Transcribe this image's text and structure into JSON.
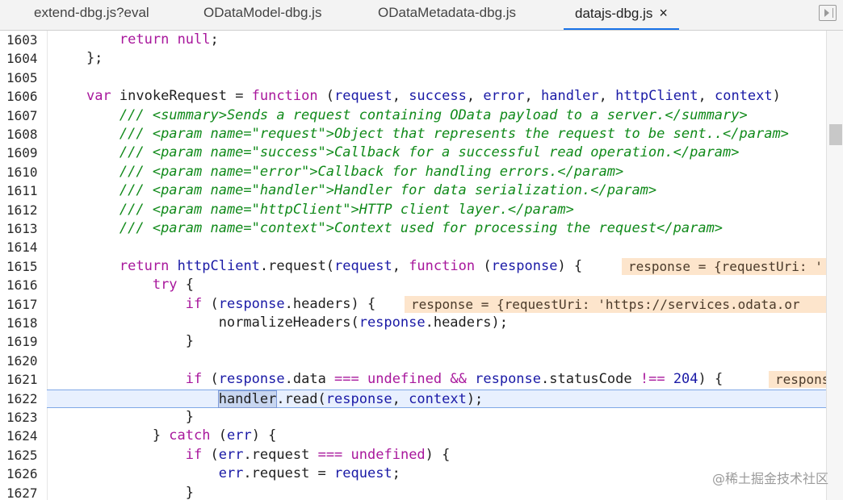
{
  "tabs": [
    {
      "label": "extend-dbg.js?eval"
    },
    {
      "label": "ODataModel-dbg.js"
    },
    {
      "label": "ODataMetadata-dbg.js"
    },
    {
      "label": "datajs-dbg.js",
      "close": "×"
    }
  ],
  "editor": {
    "lines": [
      {
        "n": "1603",
        "tokens": [
          {
            "t": "        "
          },
          {
            "t": "return",
            "c": "kw"
          },
          {
            "t": " "
          },
          {
            "t": "null",
            "c": "kw"
          },
          {
            "t": ";"
          }
        ]
      },
      {
        "n": "1604",
        "tokens": [
          {
            "t": "    };"
          }
        ]
      },
      {
        "n": "1605",
        "tokens": []
      },
      {
        "n": "1606",
        "tokens": [
          {
            "t": "    "
          },
          {
            "t": "var",
            "c": "kw"
          },
          {
            "t": " invokeRequest = "
          },
          {
            "t": "function",
            "c": "kw"
          },
          {
            "t": " ("
          },
          {
            "t": "request",
            "c": "id"
          },
          {
            "t": ", "
          },
          {
            "t": "success",
            "c": "id"
          },
          {
            "t": ", "
          },
          {
            "t": "error",
            "c": "id"
          },
          {
            "t": ", "
          },
          {
            "t": "handler",
            "c": "id"
          },
          {
            "t": ", "
          },
          {
            "t": "httpClient",
            "c": "id"
          },
          {
            "t": ", "
          },
          {
            "t": "context",
            "c": "id"
          },
          {
            "t": ")"
          }
        ]
      },
      {
        "n": "1607",
        "tokens": [
          {
            "t": "        "
          },
          {
            "t": "/// <summary>Sends a request containing OData payload to a server.</summary>",
            "c": "cm"
          }
        ]
      },
      {
        "n": "1608",
        "tokens": [
          {
            "t": "        "
          },
          {
            "t": "/// <param name=\"request\">Object that represents the request to be sent..</param>",
            "c": "cm"
          }
        ]
      },
      {
        "n": "1609",
        "tokens": [
          {
            "t": "        "
          },
          {
            "t": "/// <param name=\"success\">Callback for a successful read operation.</param>",
            "c": "cm"
          }
        ]
      },
      {
        "n": "1610",
        "tokens": [
          {
            "t": "        "
          },
          {
            "t": "/// <param name=\"error\">Callback for handling errors.</param>",
            "c": "cm"
          }
        ]
      },
      {
        "n": "1611",
        "tokens": [
          {
            "t": "        "
          },
          {
            "t": "/// <param name=\"handler\">Handler for data serialization.</param>",
            "c": "cm"
          }
        ]
      },
      {
        "n": "1612",
        "tokens": [
          {
            "t": "        "
          },
          {
            "t": "/// <param name=\"httpClient\">HTTP client layer.</param>",
            "c": "cm"
          }
        ]
      },
      {
        "n": "1613",
        "tokens": [
          {
            "t": "        "
          },
          {
            "t": "/// <param name=\"context\">Context used for processing the request</param>",
            "c": "cm"
          }
        ]
      },
      {
        "n": "1614",
        "tokens": []
      },
      {
        "n": "1615",
        "tokens": [
          {
            "t": "        "
          },
          {
            "t": "return",
            "c": "kw"
          },
          {
            "t": " "
          },
          {
            "t": "httpClient",
            "c": "id"
          },
          {
            "t": ".request("
          },
          {
            "t": "request",
            "c": "id"
          },
          {
            "t": ", "
          },
          {
            "t": "function",
            "c": "kw"
          },
          {
            "t": " ("
          },
          {
            "t": "response",
            "c": "id"
          },
          {
            "t": ") {"
          }
        ],
        "hint": "response = {requestUri: '"
      },
      {
        "n": "1616",
        "tokens": [
          {
            "t": "            "
          },
          {
            "t": "try",
            "c": "kw"
          },
          {
            "t": " {"
          }
        ]
      },
      {
        "n": "1617",
        "tokens": [
          {
            "t": "                "
          },
          {
            "t": "if",
            "c": "kw"
          },
          {
            "t": " ("
          },
          {
            "t": "response",
            "c": "id"
          },
          {
            "t": ".headers) {"
          }
        ],
        "hint": "response = {requestUri: 'https://services.odata.or"
      },
      {
        "n": "1618",
        "tokens": [
          {
            "t": "                    normalizeHeaders("
          },
          {
            "t": "response",
            "c": "id"
          },
          {
            "t": ".headers);"
          }
        ]
      },
      {
        "n": "1619",
        "tokens": [
          {
            "t": "                }"
          }
        ]
      },
      {
        "n": "1620",
        "tokens": []
      },
      {
        "n": "1621",
        "tokens": [
          {
            "t": "                "
          },
          {
            "t": "if",
            "c": "kw"
          },
          {
            "t": " ("
          },
          {
            "t": "response",
            "c": "id"
          },
          {
            "t": ".data "
          },
          {
            "t": "===",
            "c": "kw"
          },
          {
            "t": " "
          },
          {
            "t": "undefined",
            "c": "kw"
          },
          {
            "t": " "
          },
          {
            "t": "&&",
            "c": "kw"
          },
          {
            "t": " "
          },
          {
            "t": "response",
            "c": "id"
          },
          {
            "t": ".statusCode "
          },
          {
            "t": "!==",
            "c": "kw"
          },
          {
            "t": " "
          },
          {
            "t": "204",
            "c": "num"
          },
          {
            "t": ") {"
          }
        ],
        "hint": "response"
      },
      {
        "n": "1622",
        "tokens": [
          {
            "t": "                    "
          },
          {
            "t": "handler",
            "c": "sel"
          },
          {
            "t": ".read("
          },
          {
            "t": "response",
            "c": "id"
          },
          {
            "t": ", "
          },
          {
            "t": "context",
            "c": "id"
          },
          {
            "t": ");"
          }
        ],
        "current": true
      },
      {
        "n": "1623",
        "tokens": [
          {
            "t": "                }"
          }
        ]
      },
      {
        "n": "1624",
        "tokens": [
          {
            "t": "            } "
          },
          {
            "t": "catch",
            "c": "kw"
          },
          {
            "t": " ("
          },
          {
            "t": "err",
            "c": "id"
          },
          {
            "t": ") {"
          }
        ]
      },
      {
        "n": "1625",
        "tokens": [
          {
            "t": "                "
          },
          {
            "t": "if",
            "c": "kw"
          },
          {
            "t": " ("
          },
          {
            "t": "err",
            "c": "id"
          },
          {
            "t": ".request "
          },
          {
            "t": "===",
            "c": "kw"
          },
          {
            "t": " "
          },
          {
            "t": "undefined",
            "c": "kw"
          },
          {
            "t": ") {"
          }
        ]
      },
      {
        "n": "1626",
        "tokens": [
          {
            "t": "                    "
          },
          {
            "t": "err",
            "c": "id"
          },
          {
            "t": ".request = "
          },
          {
            "t": "request",
            "c": "id"
          },
          {
            "t": ";"
          }
        ]
      },
      {
        "n": "1627",
        "tokens": [
          {
            "t": "                }"
          }
        ]
      }
    ]
  },
  "watermark": "@稀土掘金技术社区"
}
